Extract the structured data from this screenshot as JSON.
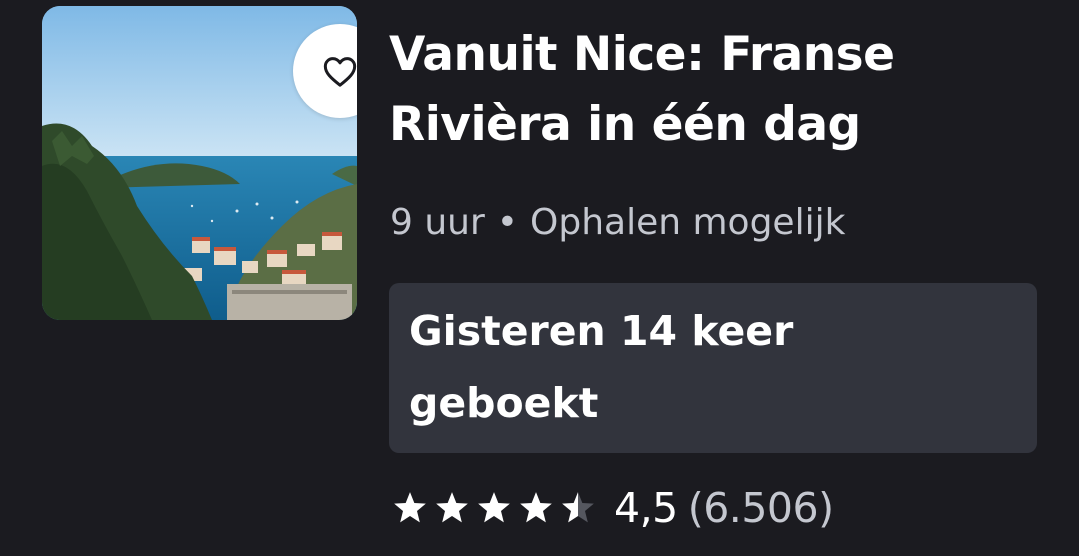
{
  "activity": {
    "title": "Vanuit Nice: Franse Rivièra in één dag",
    "duration": "9 uur",
    "separator": "•",
    "pickup": "Ophalen mogelijk",
    "booked_badge": "Gisteren 14 keer geboekt",
    "rating": {
      "value": "4,5",
      "reviews": "(6.506)",
      "stars_out_of_5": 4.5
    },
    "image_icon": "heart-outline-icon"
  },
  "colors": {
    "background": "#1b1b20",
    "badge_background": "#32343d",
    "muted_text": "#c4c7cf",
    "primary_text": "#ffffff"
  }
}
